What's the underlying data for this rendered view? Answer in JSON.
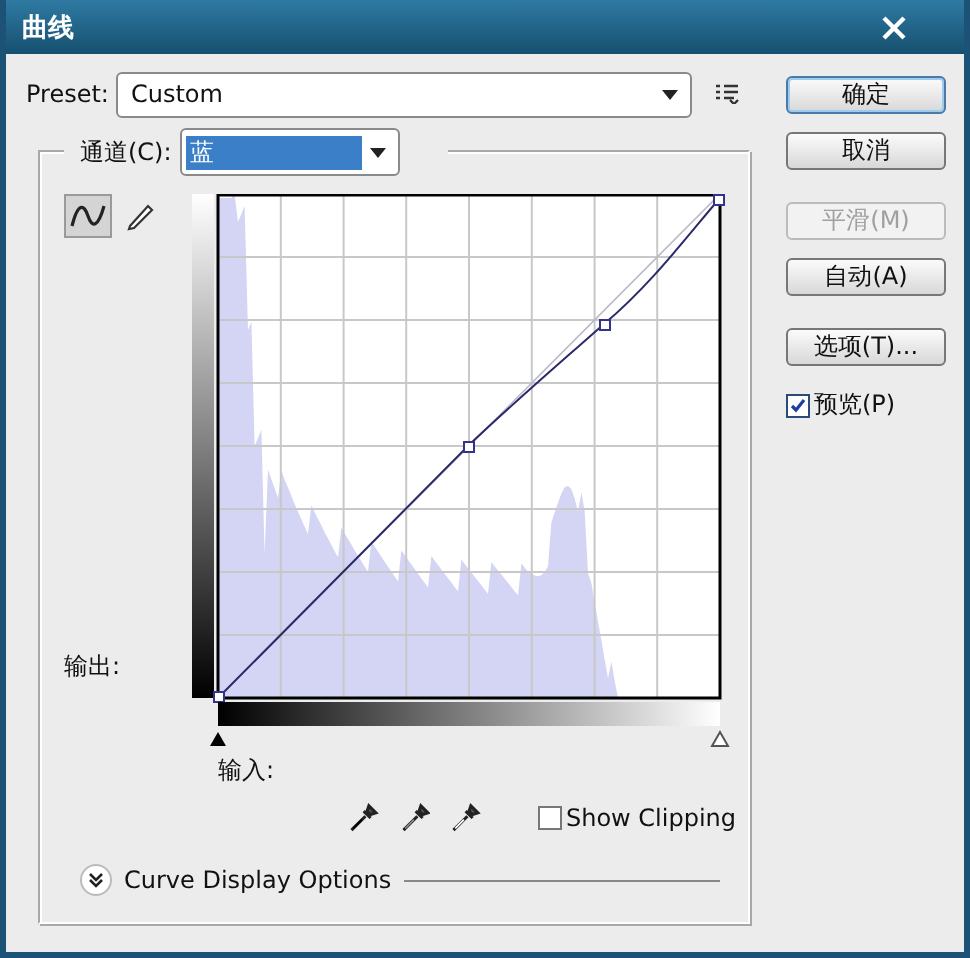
{
  "window": {
    "title": "曲线"
  },
  "preset": {
    "label": "Preset:",
    "value": "Custom"
  },
  "channel": {
    "label": "通道(C):",
    "value": "蓝"
  },
  "tools": [
    {
      "kind": "curve",
      "selected": true
    },
    {
      "kind": "pencil",
      "selected": false
    }
  ],
  "output_label": "输出:",
  "input_label": "输入:",
  "show_clipping": {
    "label": "Show Clipping",
    "checked": false
  },
  "curve_display_options": {
    "label": "Curve Display Options",
    "expanded": false
  },
  "buttons": [
    {
      "label": "确定",
      "default": true,
      "disabled": false
    },
    {
      "label": "取消",
      "default": false,
      "disabled": false
    },
    {
      "label": "平滑(M)",
      "default": false,
      "disabled": true
    },
    {
      "label": "自动(A)",
      "default": false,
      "disabled": false
    },
    {
      "label": "选项(T)...",
      "default": false,
      "disabled": false
    }
  ],
  "preview": {
    "label": "预览(P)",
    "checked": true
  }
}
